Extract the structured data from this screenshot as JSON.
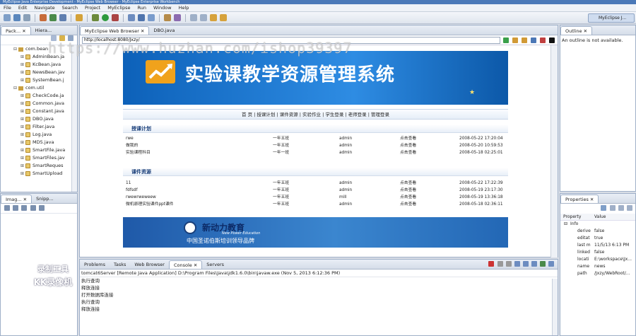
{
  "window": {
    "title": "MyEclipse Java Enterprise Development - MyEclipse Web Browser - MyEclipse Enterprise Workbench"
  },
  "menu": [
    "File",
    "Edit",
    "Navigate",
    "Search",
    "Project",
    "MyEclipse",
    "Run",
    "Window",
    "Help"
  ],
  "perspective": "MyEclipse J...",
  "left_panel": {
    "tabs": [
      "Pack...",
      "Hiera..."
    ],
    "tree": [
      {
        "label": "com.bean",
        "type": "package",
        "expanded": true,
        "indent": 1
      },
      {
        "label": "AdminBean.ja",
        "type": "java",
        "indent": 2
      },
      {
        "label": "KcBean.java",
        "type": "java",
        "indent": 2
      },
      {
        "label": "NewsBean.jav",
        "type": "java",
        "indent": 2
      },
      {
        "label": "SystemBean.j",
        "type": "java",
        "indent": 2
      },
      {
        "label": "com.util",
        "type": "package",
        "expanded": true,
        "indent": 1
      },
      {
        "label": "CheckCode.ja",
        "type": "java",
        "indent": 2
      },
      {
        "label": "Common.java",
        "type": "java",
        "indent": 2
      },
      {
        "label": "Constant.java",
        "type": "java",
        "indent": 2
      },
      {
        "label": "DBO.java",
        "type": "java",
        "indent": 2
      },
      {
        "label": "Filter.java",
        "type": "java",
        "indent": 2
      },
      {
        "label": "Log.java",
        "type": "java",
        "indent": 2
      },
      {
        "label": "MD5.java",
        "type": "java",
        "indent": 2
      },
      {
        "label": "SmartFile.java",
        "type": "java",
        "indent": 2
      },
      {
        "label": "SmartFiles.jav",
        "type": "java",
        "indent": 2
      },
      {
        "label": "SmartReques",
        "type": "java",
        "indent": 2
      },
      {
        "label": "SmartUpload",
        "type": "java",
        "indent": 2
      }
    ],
    "bottom_tabs": [
      "Imag...",
      "Snipp..."
    ]
  },
  "editor": {
    "tabs": [
      "MyEclipse Web Browser",
      "DBO.java"
    ],
    "url": "http://localhost:8080/Jxzy/"
  },
  "site": {
    "title": "实验课教学资源管理系统",
    "nav": "首 页 | 授课计划 | 课件资源 | 实验作业 | 学生登录 | 老师登录 | 管理登录",
    "section1": {
      "heading": "授课计划",
      "rows": [
        {
          "name": "rwe",
          "class": "一年五班",
          "user": "admin",
          "action": "点击查看",
          "date": "2008-05-22 17:20:04"
        },
        {
          "name": "做我的",
          "class": "一年五班",
          "user": "admin",
          "action": "点击查看",
          "date": "2008-05-20 10:59:53"
        },
        {
          "name": "实验课程科目",
          "class": "一年一班",
          "user": "admin",
          "action": "点击查看",
          "date": "2008-05-18 02:25:01"
        }
      ]
    },
    "section2": {
      "heading": "课件资源",
      "rows": [
        {
          "name": "11",
          "class": "一年五班",
          "user": "admin",
          "action": "点击查看",
          "date": "2008-05-22 17:22:39"
        },
        {
          "name": "fdfsdf",
          "class": "一年五班",
          "user": "admin",
          "action": "点击查看",
          "date": "2008-05-19 23:17:30"
        },
        {
          "name": "rwewrweweew",
          "class": "一年五班",
          "user": "mill",
          "action": "点击查看",
          "date": "2008-05-19 13:36:18"
        },
        {
          "name": "微机原理实验课件ppt课件",
          "class": "一年五班",
          "user": "admin",
          "action": "点击查看",
          "date": "2008-05-18 02:36:11"
        }
      ]
    },
    "ad": {
      "title": "新动力教育",
      "subtitle": "New Power Education",
      "slogan": "中国圣诺伯斯培训领导品牌"
    }
  },
  "outline": {
    "tab": "Outline",
    "message": "An outline is not available."
  },
  "properties": {
    "tab": "Properties",
    "col_property": "Property",
    "col_value": "Value",
    "group": "Info",
    "rows": [
      {
        "name": "derive",
        "value": "false"
      },
      {
        "name": "editat",
        "value": "true"
      },
      {
        "name": "last m",
        "value": "11/5/13 6:13 PM"
      },
      {
        "name": "linked",
        "value": "false"
      },
      {
        "name": "locati",
        "value": "E:\\workspace\\Jx..."
      },
      {
        "name": "name",
        "value": "news"
      },
      {
        "name": "path",
        "value": "/Jxzy/WebRoot/..."
      }
    ]
  },
  "console": {
    "tabs": [
      "Problems",
      "Tasks",
      "Web Browser",
      "Console",
      "Servers"
    ],
    "header": "tomcat6Server [Remote Java Application] D:\\Program Files\\Java\\jdk1.6.0\\bin\\javaw.exe (Nov 5, 2013 6:12:36 PM)",
    "lines": [
      "执行查询",
      "释放连接",
      "打开数据库连接",
      "执行查询",
      "释放连接"
    ]
  },
  "watermarks": {
    "url": "https://www.huzhan.com/ishop39397",
    "recorder1": "录制工具",
    "recorder2": "KK录像机"
  }
}
